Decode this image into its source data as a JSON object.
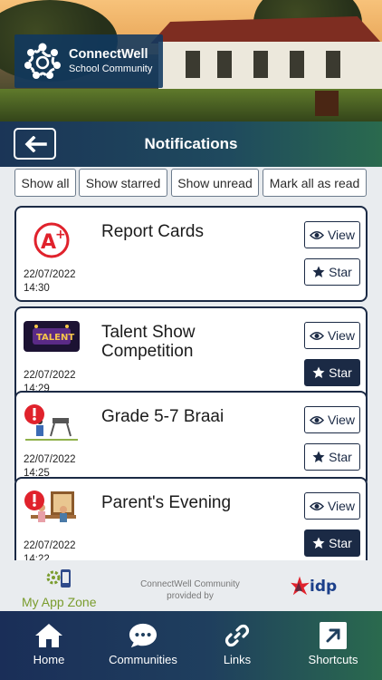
{
  "brand": {
    "name": "ConnectWell",
    "subtitle": "School Community"
  },
  "header": {
    "title": "Notifications"
  },
  "filters": [
    "Show all",
    "Show starred",
    "Show unread",
    "Mark all as read"
  ],
  "notifications": [
    {
      "title": "Report Cards",
      "date": "22/07/2022",
      "time": "14:30",
      "icon": "grade-a-plus-icon",
      "view_label": "View",
      "star_label": "Star",
      "starred": false
    },
    {
      "title": "Talent Show Competition",
      "date": "22/07/2022",
      "time": "14:29",
      "icon": "talent-show-image",
      "view_label": "View",
      "star_label": "Star",
      "starred": true
    },
    {
      "title": "Grade 5-7 Braai",
      "date": "22/07/2022",
      "time": "14:25",
      "icon": "braai-alert-image",
      "view_label": "View",
      "star_label": "Star",
      "starred": false
    },
    {
      "title": "Parent's Evening",
      "date": "22/07/2022",
      "time": "14:22",
      "icon": "parents-evening-alert-image",
      "view_label": "View",
      "star_label": "Star",
      "starred": true
    }
  ],
  "footer": {
    "app_zone": "My App Zone",
    "provided_by": "ConnectWell Community provided by",
    "partner": "idp"
  },
  "nav": [
    {
      "label": "Home",
      "icon": "home-icon"
    },
    {
      "label": "Communities",
      "icon": "chat-icon"
    },
    {
      "label": "Links",
      "icon": "link-icon"
    },
    {
      "label": "Shortcuts",
      "icon": "shortcut-arrow-icon"
    }
  ],
  "colors": {
    "navy": "#1b2a45",
    "header_start": "#1b3557",
    "header_end": "#2a6a4e",
    "alert_red": "#e0222c",
    "app_zone_green": "#7a9c2d"
  }
}
